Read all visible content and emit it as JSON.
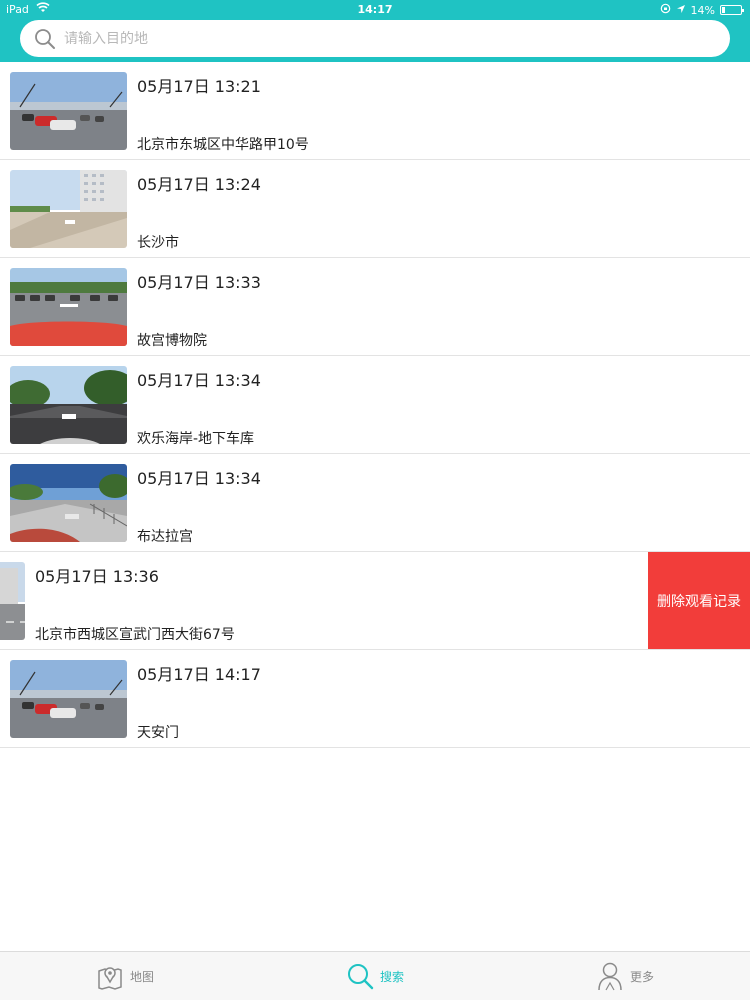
{
  "status_bar": {
    "device": "iPad",
    "time": "14:17",
    "battery": "14%",
    "battery_level": 0.14
  },
  "search": {
    "placeholder": "请输入目的地"
  },
  "history": [
    {
      "datetime": "05月17日 13:21",
      "place": "北京市东城区中华路甲10号",
      "thumb": "plaza-cars"
    },
    {
      "datetime": "05月17日 13:24",
      "place": "长沙市",
      "thumb": "building-plaza"
    },
    {
      "datetime": "05月17日 13:33",
      "place": "故宫博物院",
      "thumb": "parking-car-hood"
    },
    {
      "datetime": "05月17日 13:34",
      "place": "欢乐海岸-地下车库",
      "thumb": "tree-road"
    },
    {
      "datetime": "05月17日 13:34",
      "place": "布达拉宫",
      "thumb": "road-railing"
    },
    {
      "datetime": "05月17日 13:36",
      "place": "北京市西城区宣武门西大街67号",
      "thumb": "city-street",
      "swiped": true,
      "action": "删除观看记录"
    },
    {
      "datetime": "05月17日 14:17",
      "place": "天安门",
      "thumb": "plaza-cars"
    }
  ],
  "tabs": [
    {
      "label": "地图",
      "icon": "map-pin-icon",
      "active": false
    },
    {
      "label": "搜索",
      "icon": "search-icon",
      "active": true
    },
    {
      "label": "更多",
      "icon": "user-icon",
      "active": false
    }
  ],
  "colors": {
    "accent": "#1fc3c3",
    "delete": "#f23d3a"
  }
}
